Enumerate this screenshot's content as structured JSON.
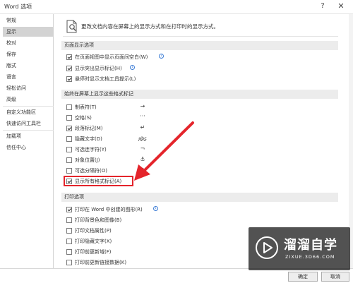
{
  "window": {
    "title": "Word 选项",
    "help_glyph": "?",
    "close_glyph": "✕"
  },
  "sidebar": {
    "items": [
      {
        "label": "常规"
      },
      {
        "label": "显示"
      },
      {
        "label": "校对"
      },
      {
        "label": "保存"
      },
      {
        "label": "版式"
      },
      {
        "label": "语言"
      },
      {
        "label": "轻松访问"
      },
      {
        "label": "高级"
      },
      {
        "label": "自定义功能区"
      },
      {
        "label": "快速访问工具栏"
      },
      {
        "label": "加载项"
      },
      {
        "label": "信任中心"
      }
    ],
    "active_index": 1
  },
  "main": {
    "intro": "更改文档内容在屏幕上的显示方式和在打印时的显示方式。",
    "page_display": {
      "header": "页面显示选项",
      "options": [
        {
          "label": "在页面视图中显示页面间空白(W)",
          "checked": true,
          "info": true
        },
        {
          "label": "显示突出显示标记(H)",
          "checked": true,
          "info": true
        },
        {
          "label": "悬停时显示文档工具提示(L)",
          "checked": true,
          "info": false
        }
      ]
    },
    "formatting_marks": {
      "header": "始终在屏幕上显示这些格式标记",
      "options": [
        {
          "label": "制表符(T)",
          "checked": false,
          "mark": "→"
        },
        {
          "label": "空格(S)",
          "checked": false,
          "mark": "···"
        },
        {
          "label": "段落标记(M)",
          "checked": true,
          "mark": "↵"
        },
        {
          "label": "隐藏文字(D)",
          "checked": false,
          "mark": "abc"
        },
        {
          "label": "可选连字符(Y)",
          "checked": false,
          "mark": "¬"
        },
        {
          "label": "对象位置(J)",
          "checked": false,
          "mark": "⚓"
        },
        {
          "label": "可选分隔符(O)",
          "checked": false,
          "mark": "▯"
        },
        {
          "label": "显示所有格式标记(A)",
          "checked": true,
          "mark": ""
        }
      ]
    },
    "print": {
      "header": "打印选项",
      "options": [
        {
          "label": "打印在 Word 中创建的图形(R)",
          "checked": true,
          "info": true
        },
        {
          "label": "打印背景色和图像(B)",
          "checked": false,
          "info": false
        },
        {
          "label": "打印文档属性(P)",
          "checked": false,
          "info": false
        },
        {
          "label": "打印隐藏文字(X)",
          "checked": false,
          "info": false
        },
        {
          "label": "打印前更新域(F)",
          "checked": false,
          "info": false
        },
        {
          "label": "打印前更新链接数据(K)",
          "checked": false,
          "info": false
        }
      ]
    }
  },
  "footer": {
    "ok_label": "确定",
    "cancel_label": "取消"
  },
  "watermark": {
    "title": "溜溜自学",
    "url": "ZIXUE.3D66.COM"
  },
  "colors": {
    "highlight": "#e4242b",
    "active_nav": "#d3d3d3",
    "section_header": "#ececec",
    "info_icon": "#3a7bd5"
  }
}
